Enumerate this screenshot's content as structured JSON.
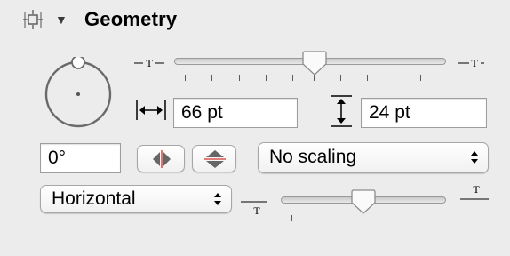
{
  "inspector": {
    "section": {
      "title": "Geometry",
      "icon": "geometry-icon",
      "disclosure_icon": "disclosure-triangle-expanded-icon"
    },
    "tracking": {
      "slider_fraction": 0.5,
      "min_icon": "tracking-tight-icon",
      "max_icon": "tracking-loose-icon"
    },
    "width": {
      "icon": "horizontal-size-arrows-icon",
      "value": "66 pt"
    },
    "height": {
      "icon": "vertical-size-arrows-icon",
      "value": "24 pt"
    },
    "rotation": {
      "value": "0°",
      "icon": "rotation-wheel-icon"
    },
    "flip": {
      "horizontal_icon": "flip-horizontal-icon",
      "vertical_icon": "flip-vertical-icon"
    },
    "scaling": {
      "selected": "No scaling"
    },
    "orientation": {
      "selected": "Horizontal"
    },
    "baseline": {
      "slider_fraction": 0.5,
      "min_icon": "baseline-low-icon",
      "max_icon": "baseline-high-icon"
    },
    "colors": {
      "panel_bg": "#ececec",
      "field_border": "#9d9d9d",
      "flip_accent": "#d9534f"
    }
  }
}
